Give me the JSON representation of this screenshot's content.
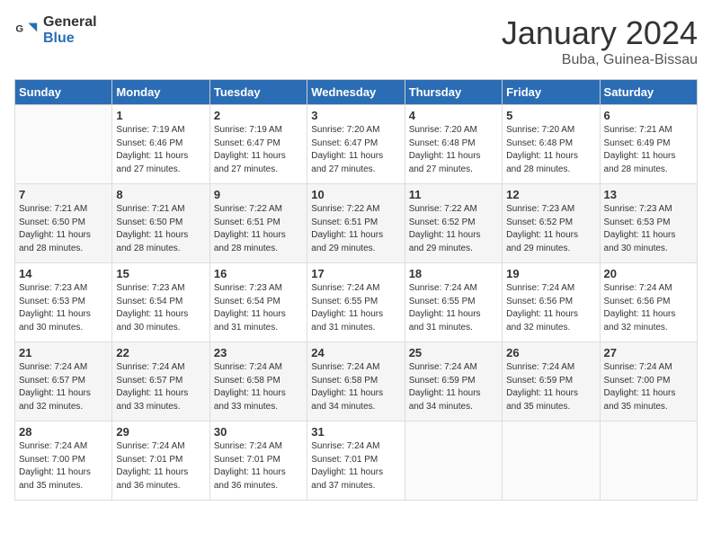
{
  "logo": {
    "general": "General",
    "blue": "Blue"
  },
  "title": "January 2024",
  "location": "Buba, Guinea-Bissau",
  "headers": [
    "Sunday",
    "Monday",
    "Tuesday",
    "Wednesday",
    "Thursday",
    "Friday",
    "Saturday"
  ],
  "weeks": [
    [
      {
        "day": "",
        "info": ""
      },
      {
        "day": "1",
        "info": "Sunrise: 7:19 AM\nSunset: 6:46 PM\nDaylight: 11 hours\nand 27 minutes."
      },
      {
        "day": "2",
        "info": "Sunrise: 7:19 AM\nSunset: 6:47 PM\nDaylight: 11 hours\nand 27 minutes."
      },
      {
        "day": "3",
        "info": "Sunrise: 7:20 AM\nSunset: 6:47 PM\nDaylight: 11 hours\nand 27 minutes."
      },
      {
        "day": "4",
        "info": "Sunrise: 7:20 AM\nSunset: 6:48 PM\nDaylight: 11 hours\nand 27 minutes."
      },
      {
        "day": "5",
        "info": "Sunrise: 7:20 AM\nSunset: 6:48 PM\nDaylight: 11 hours\nand 28 minutes."
      },
      {
        "day": "6",
        "info": "Sunrise: 7:21 AM\nSunset: 6:49 PM\nDaylight: 11 hours\nand 28 minutes."
      }
    ],
    [
      {
        "day": "7",
        "info": "Sunrise: 7:21 AM\nSunset: 6:50 PM\nDaylight: 11 hours\nand 28 minutes."
      },
      {
        "day": "8",
        "info": "Sunrise: 7:21 AM\nSunset: 6:50 PM\nDaylight: 11 hours\nand 28 minutes."
      },
      {
        "day": "9",
        "info": "Sunrise: 7:22 AM\nSunset: 6:51 PM\nDaylight: 11 hours\nand 28 minutes."
      },
      {
        "day": "10",
        "info": "Sunrise: 7:22 AM\nSunset: 6:51 PM\nDaylight: 11 hours\nand 29 minutes."
      },
      {
        "day": "11",
        "info": "Sunrise: 7:22 AM\nSunset: 6:52 PM\nDaylight: 11 hours\nand 29 minutes."
      },
      {
        "day": "12",
        "info": "Sunrise: 7:23 AM\nSunset: 6:52 PM\nDaylight: 11 hours\nand 29 minutes."
      },
      {
        "day": "13",
        "info": "Sunrise: 7:23 AM\nSunset: 6:53 PM\nDaylight: 11 hours\nand 30 minutes."
      }
    ],
    [
      {
        "day": "14",
        "info": "Sunrise: 7:23 AM\nSunset: 6:53 PM\nDaylight: 11 hours\nand 30 minutes."
      },
      {
        "day": "15",
        "info": "Sunrise: 7:23 AM\nSunset: 6:54 PM\nDaylight: 11 hours\nand 30 minutes."
      },
      {
        "day": "16",
        "info": "Sunrise: 7:23 AM\nSunset: 6:54 PM\nDaylight: 11 hours\nand 31 minutes."
      },
      {
        "day": "17",
        "info": "Sunrise: 7:24 AM\nSunset: 6:55 PM\nDaylight: 11 hours\nand 31 minutes."
      },
      {
        "day": "18",
        "info": "Sunrise: 7:24 AM\nSunset: 6:55 PM\nDaylight: 11 hours\nand 31 minutes."
      },
      {
        "day": "19",
        "info": "Sunrise: 7:24 AM\nSunset: 6:56 PM\nDaylight: 11 hours\nand 32 minutes."
      },
      {
        "day": "20",
        "info": "Sunrise: 7:24 AM\nSunset: 6:56 PM\nDaylight: 11 hours\nand 32 minutes."
      }
    ],
    [
      {
        "day": "21",
        "info": "Sunrise: 7:24 AM\nSunset: 6:57 PM\nDaylight: 11 hours\nand 32 minutes."
      },
      {
        "day": "22",
        "info": "Sunrise: 7:24 AM\nSunset: 6:57 PM\nDaylight: 11 hours\nand 33 minutes."
      },
      {
        "day": "23",
        "info": "Sunrise: 7:24 AM\nSunset: 6:58 PM\nDaylight: 11 hours\nand 33 minutes."
      },
      {
        "day": "24",
        "info": "Sunrise: 7:24 AM\nSunset: 6:58 PM\nDaylight: 11 hours\nand 34 minutes."
      },
      {
        "day": "25",
        "info": "Sunrise: 7:24 AM\nSunset: 6:59 PM\nDaylight: 11 hours\nand 34 minutes."
      },
      {
        "day": "26",
        "info": "Sunrise: 7:24 AM\nSunset: 6:59 PM\nDaylight: 11 hours\nand 35 minutes."
      },
      {
        "day": "27",
        "info": "Sunrise: 7:24 AM\nSunset: 7:00 PM\nDaylight: 11 hours\nand 35 minutes."
      }
    ],
    [
      {
        "day": "28",
        "info": "Sunrise: 7:24 AM\nSunset: 7:00 PM\nDaylight: 11 hours\nand 35 minutes."
      },
      {
        "day": "29",
        "info": "Sunrise: 7:24 AM\nSunset: 7:01 PM\nDaylight: 11 hours\nand 36 minutes."
      },
      {
        "day": "30",
        "info": "Sunrise: 7:24 AM\nSunset: 7:01 PM\nDaylight: 11 hours\nand 36 minutes."
      },
      {
        "day": "31",
        "info": "Sunrise: 7:24 AM\nSunset: 7:01 PM\nDaylight: 11 hours\nand 37 minutes."
      },
      {
        "day": "",
        "info": ""
      },
      {
        "day": "",
        "info": ""
      },
      {
        "day": "",
        "info": ""
      }
    ]
  ]
}
